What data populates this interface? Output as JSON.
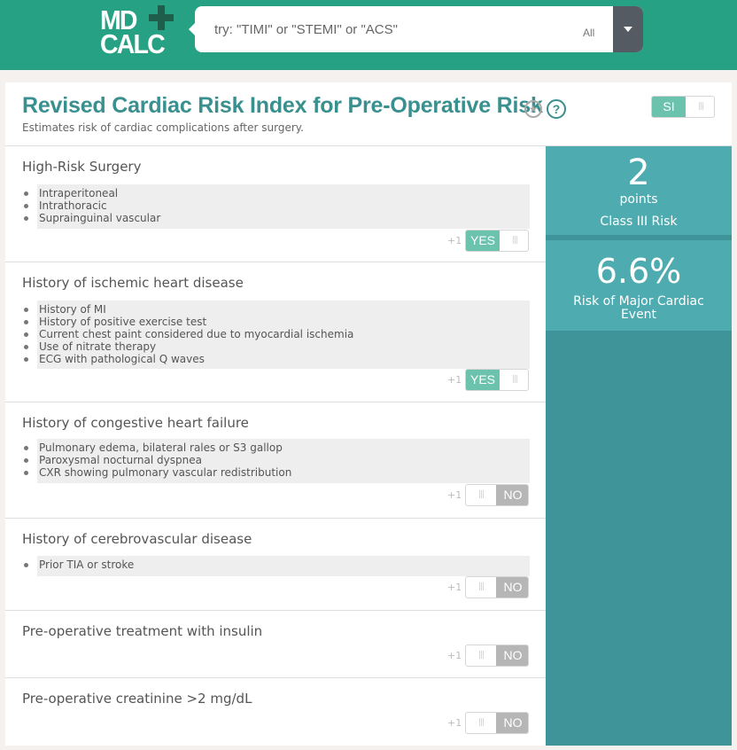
{
  "header": {
    "logo_top": "MD",
    "logo_bottom": "CALC",
    "search_placeholder": "try: \"TIMI\" or \"STEMI\" or \"ACS\"",
    "search_scope": "All"
  },
  "calculator": {
    "title": "Revised Cardiac Risk Index for Pre-Operative Risk",
    "subtitle": "Estimates risk of cardiac complications after surgery.",
    "unit_toggle_label": "SI",
    "unit_toggle_grip": "|||"
  },
  "criteria": [
    {
      "title": "High-Risk Surgery",
      "items": [
        "Intraperitoneal",
        "Intrathoracic",
        "Suprainguinal vascular"
      ],
      "points": "+1",
      "value": "YES",
      "selected": true
    },
    {
      "title": "History of ischemic heart disease",
      "items": [
        "History of MI",
        "History of positive exercise test",
        "Current chest paint considered due to myocardial ischemia",
        "Use of nitrate therapy",
        "ECG with pathological Q waves"
      ],
      "points": "+1",
      "value": "YES",
      "selected": true
    },
    {
      "title": "History of congestive heart failure",
      "items": [
        "Pulmonary edema, bilateral rales or S3 gallop",
        "Paroxysmal nocturnal dyspnea",
        "CXR showing pulmonary vascular redistribution"
      ],
      "points": "+1",
      "value": "NO",
      "selected": false
    },
    {
      "title": "History of cerebrovascular disease",
      "items": [
        "Prior TIA or stroke"
      ],
      "points": "+1",
      "value": "NO",
      "selected": false
    },
    {
      "title": "Pre-operative treatment with insulin",
      "items": [],
      "points": "+1",
      "value": "NO",
      "selected": false
    },
    {
      "title": "Pre-operative creatinine >2 mg/dL",
      "items": [],
      "points": "+1",
      "value": "NO",
      "selected": false
    }
  ],
  "result": {
    "score": "2",
    "score_unit": "points",
    "risk_class": "Class III Risk",
    "risk_percent": "6.6%",
    "risk_label": "Risk of Major Cardiac Event"
  },
  "colors": {
    "brand": "#27a184",
    "title": "#3a8f8f",
    "toggle_on": "#6cc3ad",
    "toggle_off": "#b6b6b6",
    "result_panel": "#4eabb0",
    "result_bg": "#3f9499"
  }
}
